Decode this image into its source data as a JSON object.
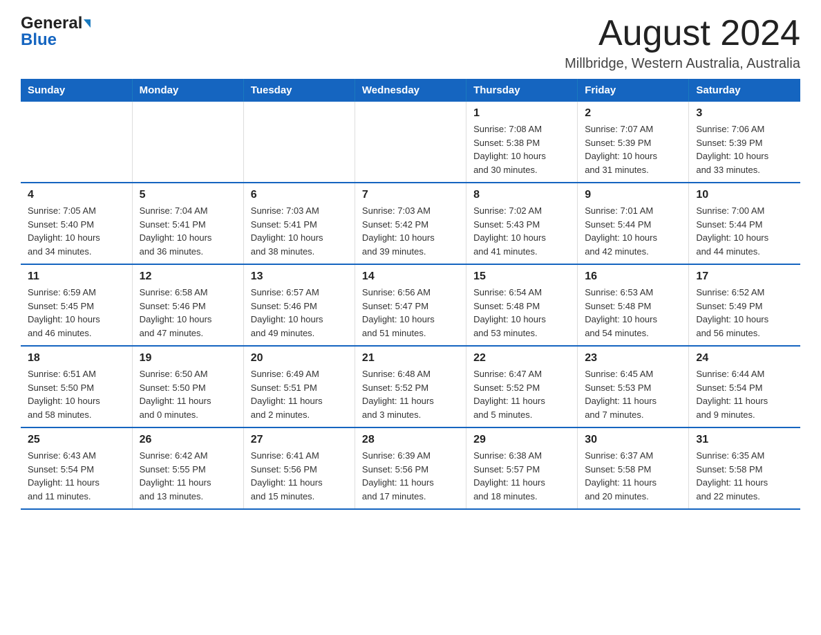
{
  "header": {
    "logo_general": "General",
    "logo_blue": "Blue",
    "month_title": "August 2024",
    "location": "Millbridge, Western Australia, Australia"
  },
  "weekdays": [
    "Sunday",
    "Monday",
    "Tuesday",
    "Wednesday",
    "Thursday",
    "Friday",
    "Saturday"
  ],
  "weeks": [
    [
      {
        "day": "",
        "info": ""
      },
      {
        "day": "",
        "info": ""
      },
      {
        "day": "",
        "info": ""
      },
      {
        "day": "",
        "info": ""
      },
      {
        "day": "1",
        "info": "Sunrise: 7:08 AM\nSunset: 5:38 PM\nDaylight: 10 hours\nand 30 minutes."
      },
      {
        "day": "2",
        "info": "Sunrise: 7:07 AM\nSunset: 5:39 PM\nDaylight: 10 hours\nand 31 minutes."
      },
      {
        "day": "3",
        "info": "Sunrise: 7:06 AM\nSunset: 5:39 PM\nDaylight: 10 hours\nand 33 minutes."
      }
    ],
    [
      {
        "day": "4",
        "info": "Sunrise: 7:05 AM\nSunset: 5:40 PM\nDaylight: 10 hours\nand 34 minutes."
      },
      {
        "day": "5",
        "info": "Sunrise: 7:04 AM\nSunset: 5:41 PM\nDaylight: 10 hours\nand 36 minutes."
      },
      {
        "day": "6",
        "info": "Sunrise: 7:03 AM\nSunset: 5:41 PM\nDaylight: 10 hours\nand 38 minutes."
      },
      {
        "day": "7",
        "info": "Sunrise: 7:03 AM\nSunset: 5:42 PM\nDaylight: 10 hours\nand 39 minutes."
      },
      {
        "day": "8",
        "info": "Sunrise: 7:02 AM\nSunset: 5:43 PM\nDaylight: 10 hours\nand 41 minutes."
      },
      {
        "day": "9",
        "info": "Sunrise: 7:01 AM\nSunset: 5:44 PM\nDaylight: 10 hours\nand 42 minutes."
      },
      {
        "day": "10",
        "info": "Sunrise: 7:00 AM\nSunset: 5:44 PM\nDaylight: 10 hours\nand 44 minutes."
      }
    ],
    [
      {
        "day": "11",
        "info": "Sunrise: 6:59 AM\nSunset: 5:45 PM\nDaylight: 10 hours\nand 46 minutes."
      },
      {
        "day": "12",
        "info": "Sunrise: 6:58 AM\nSunset: 5:46 PM\nDaylight: 10 hours\nand 47 minutes."
      },
      {
        "day": "13",
        "info": "Sunrise: 6:57 AM\nSunset: 5:46 PM\nDaylight: 10 hours\nand 49 minutes."
      },
      {
        "day": "14",
        "info": "Sunrise: 6:56 AM\nSunset: 5:47 PM\nDaylight: 10 hours\nand 51 minutes."
      },
      {
        "day": "15",
        "info": "Sunrise: 6:54 AM\nSunset: 5:48 PM\nDaylight: 10 hours\nand 53 minutes."
      },
      {
        "day": "16",
        "info": "Sunrise: 6:53 AM\nSunset: 5:48 PM\nDaylight: 10 hours\nand 54 minutes."
      },
      {
        "day": "17",
        "info": "Sunrise: 6:52 AM\nSunset: 5:49 PM\nDaylight: 10 hours\nand 56 minutes."
      }
    ],
    [
      {
        "day": "18",
        "info": "Sunrise: 6:51 AM\nSunset: 5:50 PM\nDaylight: 10 hours\nand 58 minutes."
      },
      {
        "day": "19",
        "info": "Sunrise: 6:50 AM\nSunset: 5:50 PM\nDaylight: 11 hours\nand 0 minutes."
      },
      {
        "day": "20",
        "info": "Sunrise: 6:49 AM\nSunset: 5:51 PM\nDaylight: 11 hours\nand 2 minutes."
      },
      {
        "day": "21",
        "info": "Sunrise: 6:48 AM\nSunset: 5:52 PM\nDaylight: 11 hours\nand 3 minutes."
      },
      {
        "day": "22",
        "info": "Sunrise: 6:47 AM\nSunset: 5:52 PM\nDaylight: 11 hours\nand 5 minutes."
      },
      {
        "day": "23",
        "info": "Sunrise: 6:45 AM\nSunset: 5:53 PM\nDaylight: 11 hours\nand 7 minutes."
      },
      {
        "day": "24",
        "info": "Sunrise: 6:44 AM\nSunset: 5:54 PM\nDaylight: 11 hours\nand 9 minutes."
      }
    ],
    [
      {
        "day": "25",
        "info": "Sunrise: 6:43 AM\nSunset: 5:54 PM\nDaylight: 11 hours\nand 11 minutes."
      },
      {
        "day": "26",
        "info": "Sunrise: 6:42 AM\nSunset: 5:55 PM\nDaylight: 11 hours\nand 13 minutes."
      },
      {
        "day": "27",
        "info": "Sunrise: 6:41 AM\nSunset: 5:56 PM\nDaylight: 11 hours\nand 15 minutes."
      },
      {
        "day": "28",
        "info": "Sunrise: 6:39 AM\nSunset: 5:56 PM\nDaylight: 11 hours\nand 17 minutes."
      },
      {
        "day": "29",
        "info": "Sunrise: 6:38 AM\nSunset: 5:57 PM\nDaylight: 11 hours\nand 18 minutes."
      },
      {
        "day": "30",
        "info": "Sunrise: 6:37 AM\nSunset: 5:58 PM\nDaylight: 11 hours\nand 20 minutes."
      },
      {
        "day": "31",
        "info": "Sunrise: 6:35 AM\nSunset: 5:58 PM\nDaylight: 11 hours\nand 22 minutes."
      }
    ]
  ]
}
